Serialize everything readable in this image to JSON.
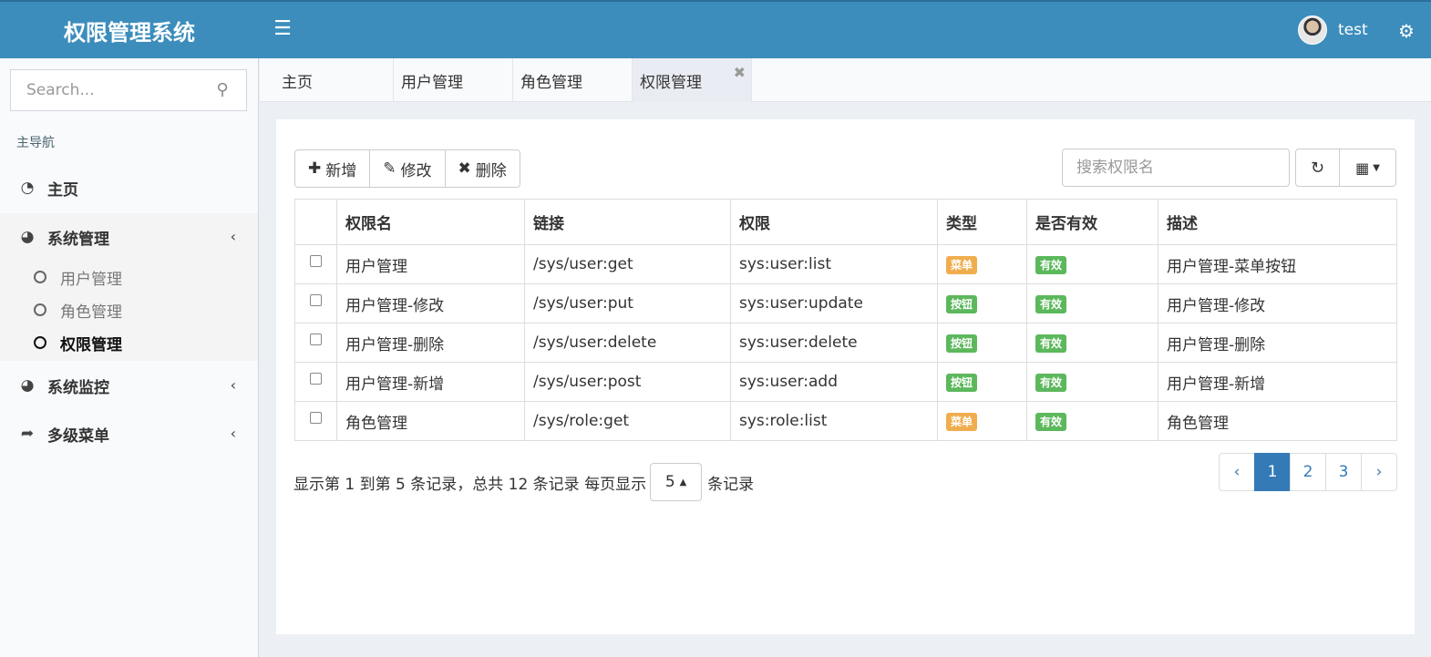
{
  "app": {
    "title": "权限管理系统"
  },
  "header": {
    "username": "test"
  },
  "sidebar": {
    "search_placeholder": "Search...",
    "nav_header": "主导航",
    "items": [
      {
        "label": "主页",
        "icon": "dashboard-icon"
      },
      {
        "label": "系统管理",
        "icon": "pie-chart-icon",
        "expanded": true,
        "children": [
          {
            "label": "用户管理"
          },
          {
            "label": "角色管理"
          },
          {
            "label": "权限管理",
            "current": true
          }
        ]
      },
      {
        "label": "系统监控",
        "icon": "pie-chart-icon"
      },
      {
        "label": "多级菜单",
        "icon": "share-icon"
      }
    ]
  },
  "tabs": [
    {
      "label": "主页"
    },
    {
      "label": "用户管理"
    },
    {
      "label": "角色管理"
    },
    {
      "label": "权限管理",
      "active": true
    }
  ],
  "toolbar": {
    "add_label": "新增",
    "edit_label": "修改",
    "delete_label": "删除"
  },
  "table_search": {
    "placeholder": "搜索权限名"
  },
  "table": {
    "columns": [
      "权限名",
      "链接",
      "权限",
      "类型",
      "是否有效",
      "描述"
    ],
    "rows": [
      {
        "name": "用户管理",
        "url": "/sys/user:get",
        "perm": "sys:user:list",
        "type": "菜单",
        "valid": "有效",
        "desc": "用户管理-菜单按钮"
      },
      {
        "name": "用户管理-修改",
        "url": "/sys/user:put",
        "perm": "sys:user:update",
        "type": "按钮",
        "valid": "有效",
        "desc": "用户管理-修改"
      },
      {
        "name": "用户管理-删除",
        "url": "/sys/user:delete",
        "perm": "sys:user:delete",
        "type": "按钮",
        "valid": "有效",
        "desc": "用户管理-删除"
      },
      {
        "name": "用户管理-新增",
        "url": "/sys/user:post",
        "perm": "sys:user:add",
        "type": "按钮",
        "valid": "有效",
        "desc": "用户管理-新增"
      },
      {
        "name": "角色管理",
        "url": "/sys/role:get",
        "perm": "sys:role:list",
        "type": "菜单",
        "valid": "有效",
        "desc": "角色管理"
      }
    ]
  },
  "pager": {
    "summary": "显示第 1 到第 5 条记录，总共 12 条记录 每页显示",
    "page_size": "5",
    "suffix": "条记录",
    "prev": "‹",
    "next": "›",
    "pages": [
      "1",
      "2",
      "3"
    ],
    "current": "1"
  },
  "colors": {
    "header": "#3c8dbc",
    "menu_badge": "#f0ad4e",
    "button_badge": "#5cb85c",
    "valid_badge": "#5cb85c",
    "pagination_active": "#337ab7"
  }
}
